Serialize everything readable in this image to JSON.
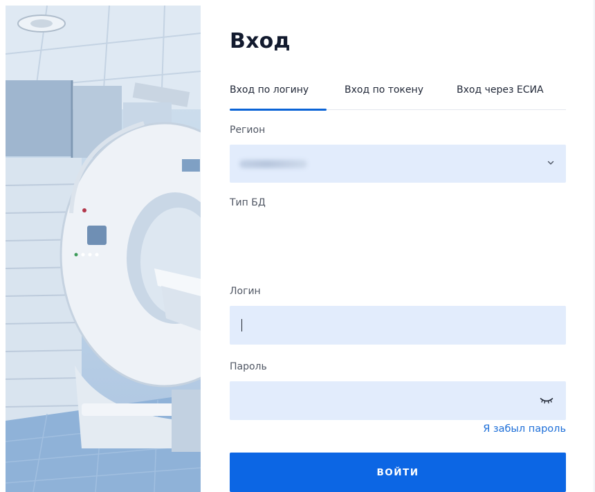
{
  "login": {
    "title": "Вход",
    "tabs": [
      {
        "label": "Вход по логину",
        "active": true
      },
      {
        "label": "Вход по токену",
        "active": false
      },
      {
        "label": "Вход через ЕСИА",
        "active": false
      }
    ],
    "region": {
      "label": "Регион",
      "value_obscured": true
    },
    "db_type": {
      "label": "Тип БД"
    },
    "login_field": {
      "label": "Логин",
      "value": ""
    },
    "password_field": {
      "label": "Пароль",
      "value": ""
    },
    "forgot_link": "Я забыл пароль",
    "submit_label": "ВОЙТИ"
  },
  "icons": {
    "region_dropdown": "chevron-down-icon",
    "password_toggle": "eye-closed-icon"
  },
  "colors": {
    "accent": "#0c66e4",
    "field_background": "#e2ecfc",
    "link": "#1c6ed8",
    "title": "#121a2e"
  }
}
